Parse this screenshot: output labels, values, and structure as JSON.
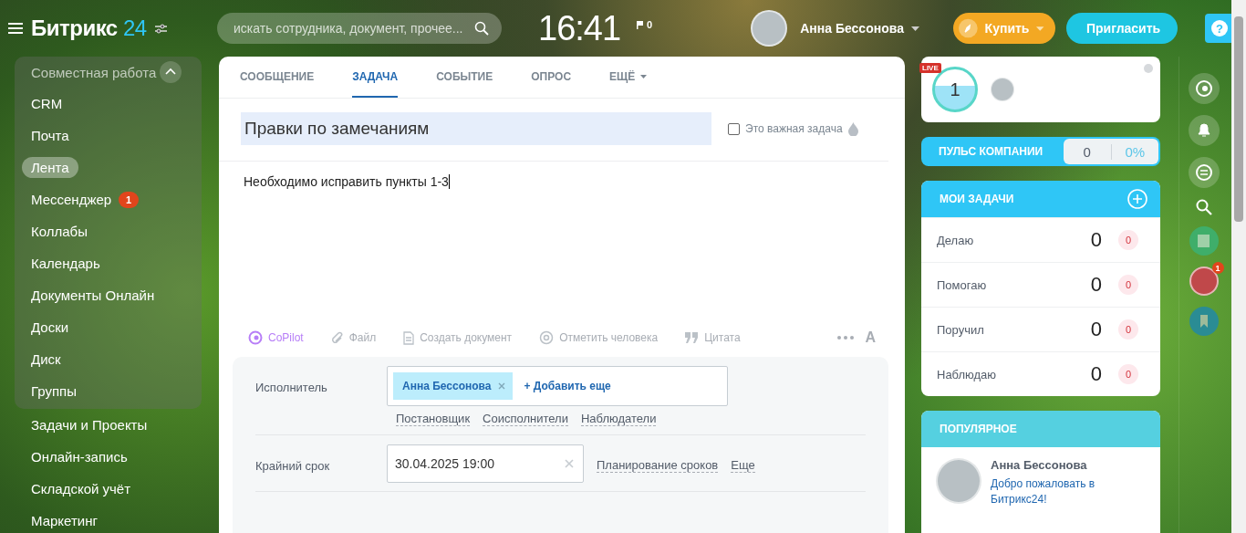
{
  "header": {
    "logo_name": "Битрикс",
    "logo_number": "24",
    "search": {
      "placeholder": "искать сотрудника, документ, прочее..."
    },
    "clock": "16:41",
    "flags": "0",
    "user": "Анна Бессонова",
    "buy": "Купить",
    "invite": "Пригласить",
    "help": "?"
  },
  "sidebar": {
    "group": {
      "title": "Совместная работа",
      "expanded": true,
      "items": [
        {
          "label": "CRM",
          "selected": false
        },
        {
          "label": "Почта",
          "selected": false
        },
        {
          "label": "Лента",
          "selected": true
        },
        {
          "label": "Мессенджер",
          "selected": false,
          "badge": "1"
        },
        {
          "label": "Коллабы",
          "selected": false
        },
        {
          "label": "Календарь",
          "selected": false
        },
        {
          "label": "Документы Онлайн",
          "selected": false
        },
        {
          "label": "Доски",
          "selected": false
        },
        {
          "label": "Диск",
          "selected": false
        },
        {
          "label": "Группы",
          "selected": false
        }
      ]
    },
    "items": [
      {
        "label": "Задачи и Проекты",
        "selected": false
      },
      {
        "label": "Онлайн-запись",
        "selected": false
      },
      {
        "label": "Складской учёт",
        "selected": false
      },
      {
        "label": "Маркетинг",
        "selected": false
      }
    ]
  },
  "composer": {
    "tabs": [
      {
        "label": "СООБЩЕНИЕ",
        "selected": false
      },
      {
        "label": "ЗАДАЧА",
        "selected": true
      },
      {
        "label": "СОБЫТИЕ",
        "selected": false
      },
      {
        "label": "ОПРОС",
        "selected": false
      },
      {
        "label": "ЕЩЁ",
        "selected": false,
        "dropdown": true
      }
    ],
    "title": "Правки по замечаниям",
    "important": {
      "label": "Это важная задача",
      "checked": false
    },
    "description": "Необходимо исправить пункты 1-3",
    "toolbar": [
      {
        "kind": "copilot",
        "label": "CoPilot"
      },
      {
        "kind": "file",
        "label": "Файл"
      },
      {
        "kind": "document",
        "label": "Создать документ"
      },
      {
        "kind": "mention",
        "label": "Отметить человека"
      },
      {
        "kind": "quote",
        "label": "Цитата"
      }
    ],
    "format_letter": "A",
    "assignee": {
      "label": "Исполнитель",
      "chip": "Анна Бессонова",
      "add": "+ Добавить еще",
      "roles": [
        "Постановщик",
        "Соисполнители",
        "Наблюдатели"
      ]
    },
    "deadline": {
      "label": "Крайний срок",
      "value": "30.04.2025 19:00",
      "links": [
        "Планирование сроков",
        "Еще"
      ]
    }
  },
  "live": {
    "badge": "LIVE",
    "count": "1"
  },
  "pulse": {
    "title": "ПУЛЬС КОМПАНИИ",
    "value": "0",
    "percent": "0%"
  },
  "tasks": {
    "title": "МОИ ЗАДАЧИ",
    "rows": [
      {
        "label": "Делаю",
        "count": "0",
        "expired": "0"
      },
      {
        "label": "Помогаю",
        "count": "0",
        "expired": "0"
      },
      {
        "label": "Поручил",
        "count": "0",
        "expired": "0"
      },
      {
        "label": "Наблюдаю",
        "count": "0",
        "expired": "0"
      }
    ]
  },
  "popular": {
    "title": "ПОПУЛЯРНОЕ",
    "author": "Анна Бессонова",
    "text": "Добро пожаловать в Битрикс24!"
  },
  "rail": {
    "chat_badge": "1"
  }
}
